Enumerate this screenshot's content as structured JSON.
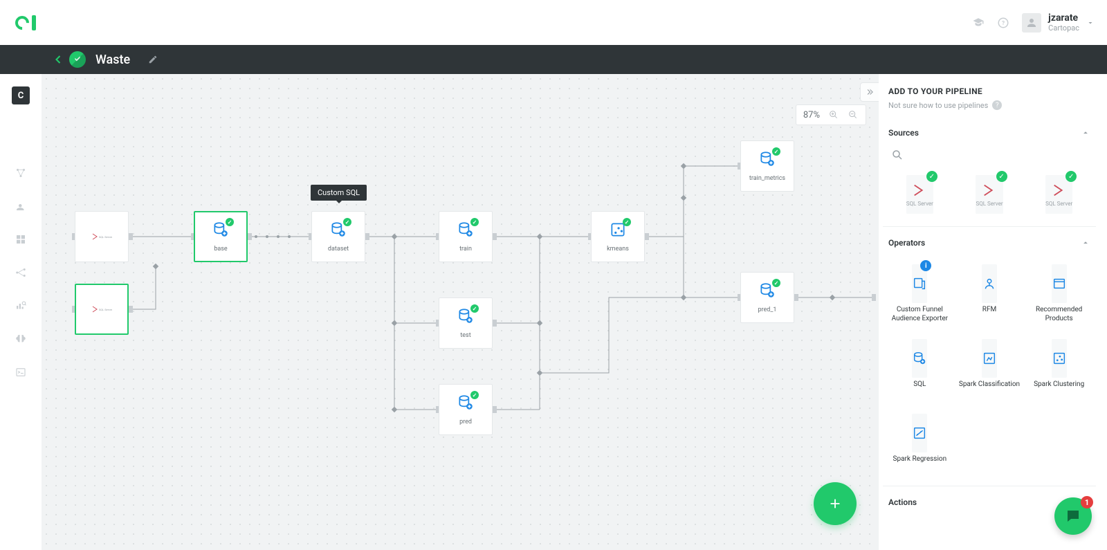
{
  "user": {
    "name": "jzarate",
    "org": "Cartopac"
  },
  "project": {
    "title": "Waste"
  },
  "left_rail": {
    "square_label": "C"
  },
  "canvas": {
    "zoom_label": "87%",
    "tooltip": "Custom SQL",
    "nodes": {
      "base": "base",
      "dataset": "dataset",
      "train": "train",
      "test": "test",
      "pred": "pred",
      "kmeans": "kmeans",
      "train_metrics": "train_metrics",
      "pred_1": "pred_1"
    }
  },
  "right_panel": {
    "title": "ADD TO YOUR PIPELINE",
    "subtitle": "Not sure how to use pipelines",
    "sections": {
      "sources": "Sources",
      "operators": "Operators",
      "actions": "Actions"
    },
    "source_tile_label": "SQL Server",
    "operators": [
      "Custom Funnel Audience Exporter",
      "RFM",
      "Recommended Products",
      "SQL",
      "Spark Classification",
      "Spark Clustering",
      "Spark Regression"
    ]
  },
  "chat": {
    "badge": "1"
  }
}
